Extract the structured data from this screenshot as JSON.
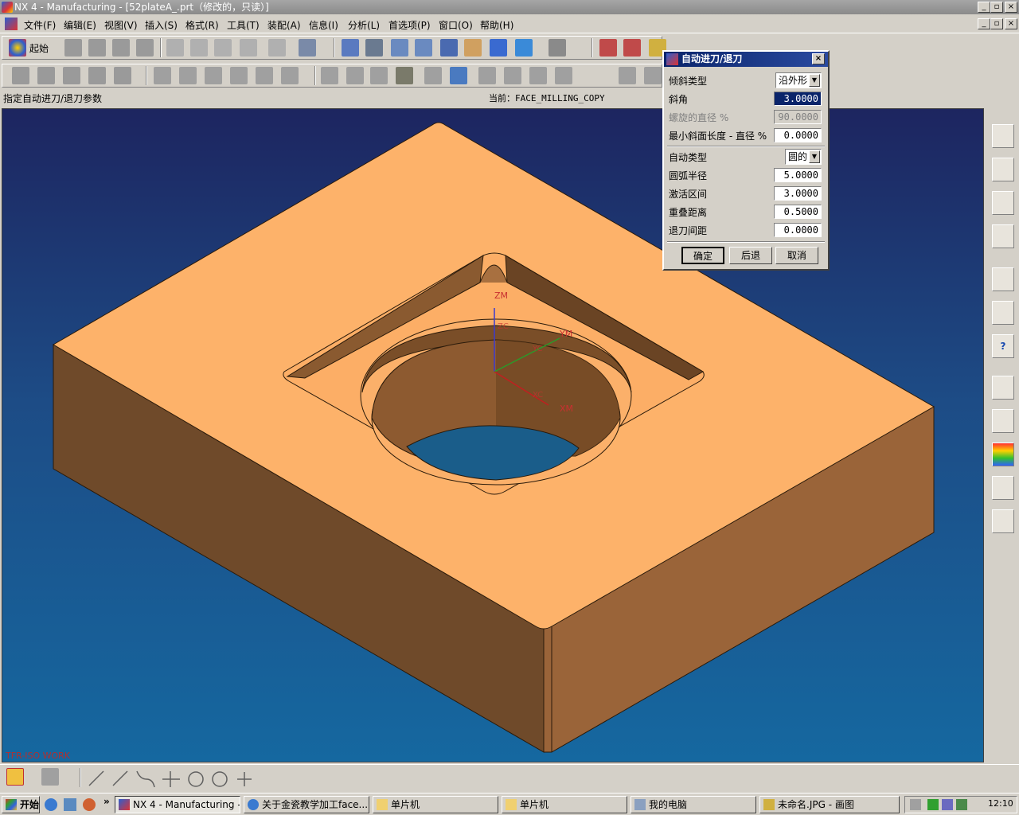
{
  "window": {
    "title": "NX 4 - Manufacturing - [52plateA_.prt（修改的，只读）]"
  },
  "menu": [
    "文件(F)",
    "编辑(E)",
    "视图(V)",
    "插入(S)",
    "格式(R)",
    "工具(T)",
    "装配(A)",
    "信息(I)",
    "分析(L)",
    "首选项(P)",
    "窗口(O)",
    "帮助(H)"
  ],
  "toolbar": {
    "start_label": "起始"
  },
  "cue": {
    "prompt": "指定自动进刀/退刀参数",
    "current": "当前：FACE_MILLING_COPY"
  },
  "viewport": {
    "axes": {
      "zm": "ZM",
      "ym": "YM",
      "xm": "XM",
      "zc": "ZC",
      "yc": "YC",
      "xc": "XC"
    },
    "watermark": "TFR-ISO WORK",
    "colors": {
      "top": "#fdb26a",
      "left": "#6f4a2a",
      "right": "#9a6439",
      "hole": "#1a5d8a"
    }
  },
  "dialog": {
    "title": "自动进刀/退刀",
    "ramp_type_label": "倾斜类型",
    "ramp_type_value": "沿外形",
    "ramp_angle_label": "斜角",
    "ramp_angle_value": "3.0000",
    "helix_label": "螺旋的直径 %",
    "helix_value": "90.0000",
    "min_ramp_label": "最小斜面长度 - 直径 %",
    "min_ramp_value": "0.0000",
    "auto_type_label": "自动类型",
    "auto_type_value": "圆的",
    "arc_radius_label": "圆弧半径",
    "arc_radius_value": "5.0000",
    "activation_label": "激活区间",
    "activation_value": "3.0000",
    "overlap_label": "重叠距离",
    "overlap_value": "0.5000",
    "retract_label": "退刀间距",
    "retract_value": "0.0000",
    "ok": "确定",
    "back": "后退",
    "cancel": "取消"
  },
  "taskbar": {
    "start": "开始",
    "chevron": "»",
    "tasks": [
      "NX 4 - Manufacturing - [...",
      "关于金瓷教学加工face...",
      "单片机",
      "单片机",
      "我的电脑",
      "未命名.JPG - 画图"
    ],
    "clock": "12:10"
  }
}
